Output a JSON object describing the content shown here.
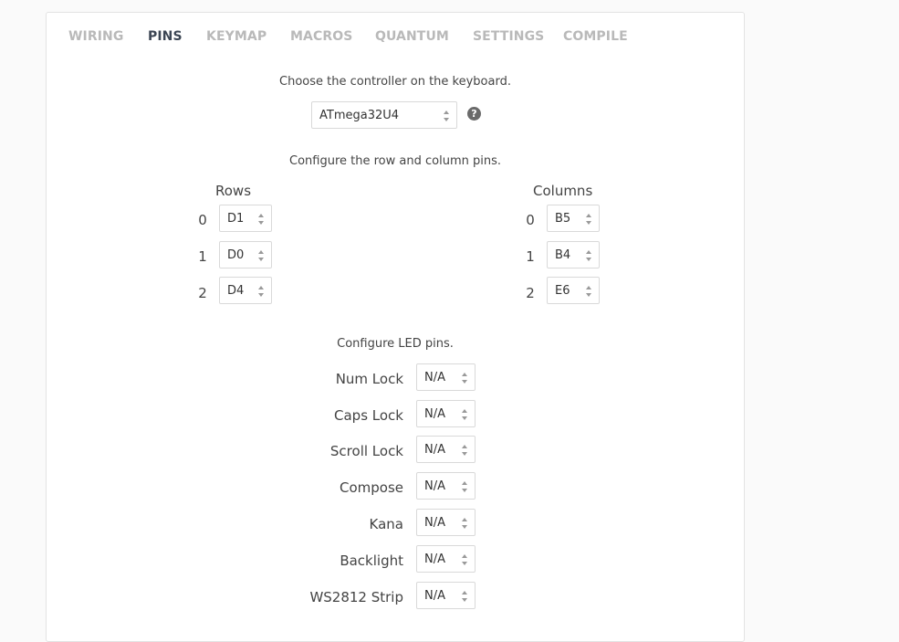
{
  "tabs": [
    {
      "label": "WIRING",
      "active": false
    },
    {
      "label": "PINS",
      "active": true
    },
    {
      "label": "KEYMAP",
      "active": false
    },
    {
      "label": "MACROS",
      "active": false
    },
    {
      "label": "QUANTUM",
      "active": false
    },
    {
      "label": "SETTINGS",
      "active": false
    },
    {
      "label": "COMPILE",
      "active": false
    }
  ],
  "controller": {
    "prompt": "Choose the controller on the keyboard.",
    "selected": "ATmega32U4",
    "help_icon": "question-circle-icon",
    "help_glyph": "?"
  },
  "matrix": {
    "prompt": "Configure the row and column pins.",
    "rows_heading": "Rows",
    "columns_heading": "Columns",
    "rows": [
      {
        "index": "0",
        "pin": "D1"
      },
      {
        "index": "1",
        "pin": "D0"
      },
      {
        "index": "2",
        "pin": "D4"
      }
    ],
    "columns": [
      {
        "index": "0",
        "pin": "B5"
      },
      {
        "index": "1",
        "pin": "B4"
      },
      {
        "index": "2",
        "pin": "E6"
      }
    ]
  },
  "leds": {
    "prompt": "Configure LED pins.",
    "items": [
      {
        "label": "Num Lock",
        "value": "N/A"
      },
      {
        "label": "Caps Lock",
        "value": "N/A"
      },
      {
        "label": "Scroll Lock",
        "value": "N/A"
      },
      {
        "label": "Compose",
        "value": "N/A"
      },
      {
        "label": "Kana",
        "value": "N/A"
      },
      {
        "label": "Backlight",
        "value": "N/A"
      },
      {
        "label": "WS2812 Strip",
        "value": "N/A"
      }
    ]
  },
  "colors": {
    "active_tab": "#3c4654",
    "inactive_tab": "#b9b9b9",
    "border": "#d9d9d9"
  }
}
